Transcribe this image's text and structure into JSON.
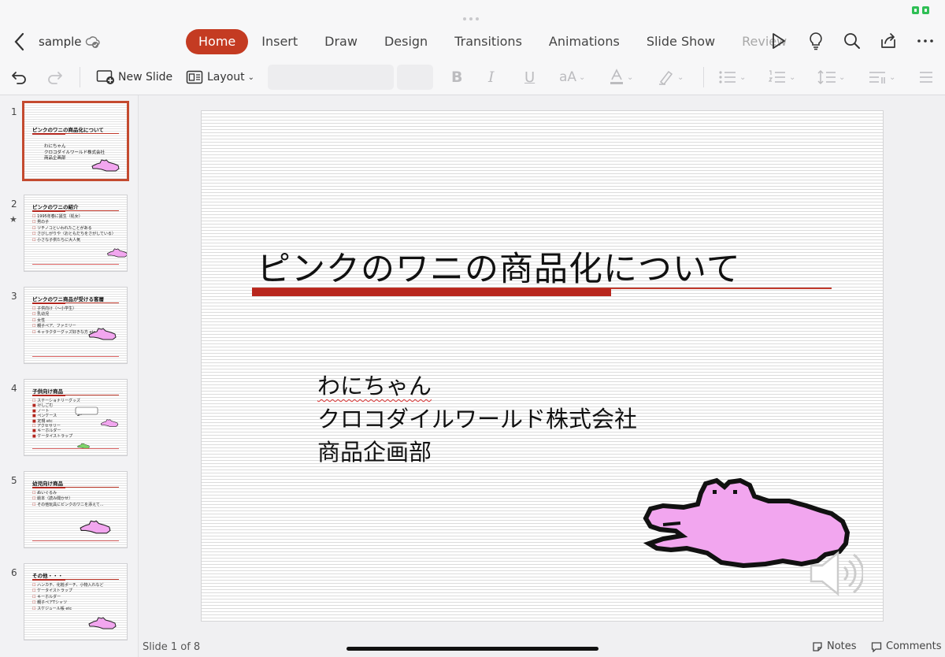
{
  "doc": {
    "title": "sample"
  },
  "tabs": [
    {
      "label": "Home",
      "active": true
    },
    {
      "label": "Insert"
    },
    {
      "label": "Draw"
    },
    {
      "label": "Design"
    },
    {
      "label": "Transitions"
    },
    {
      "label": "Animations"
    },
    {
      "label": "Slide Show"
    },
    {
      "label": "Review"
    }
  ],
  "ribbon": {
    "new_slide": "New Slide",
    "layout": "Layout",
    "font_case": "aA"
  },
  "slide": {
    "title": "ピンクのワニの商品化について",
    "subtitle_lines": [
      "わにちゃん",
      "クロコダイルワールド株式会社",
      "商品企画部"
    ]
  },
  "thumbnails": [
    {
      "num": "1",
      "title": "ピンクのワニの商品化について",
      "sub": [
        "わにちゃん",
        "クロコダイルワールド株式会社",
        "商品企画部"
      ]
    },
    {
      "num": "2",
      "title": "ピンクのワニの紹介",
      "items": [
        "1995年春に誕生（処女）",
        "男の子",
        "ツチノコといわれたことがある",
        "さびしがりや（おともだちをさがしている）",
        "小さな子供たちに大人気"
      ]
    },
    {
      "num": "3",
      "title": "ピンクのワニ商品が受ける客層",
      "items": [
        "子供向け（〜小学生）",
        "乳幼児",
        "女性",
        "親子ペア、ファミリー",
        "キャラクターグッズ好きな方 etc..."
      ]
    },
    {
      "num": "4",
      "title": "子供向け商品",
      "items": [
        "ステーショナリーグッズ",
        "けしごむ",
        "ノート",
        "ペンケース",
        "定規 etc",
        "アクセサリー",
        "キーホルダー",
        "ケータイストラップ"
      ]
    },
    {
      "num": "5",
      "title": "幼児向け商品",
      "items": [
        "ぬいぐるみ",
        "絵本（読み聞かせ）",
        "その他玩具にピンクのワニを添えて..."
      ]
    },
    {
      "num": "6",
      "title": "その他・・・",
      "items": [
        "ハンカチ、化粧ポーチ、小物入れなど",
        "ケータイストラップ",
        "キーホルダー",
        "親子ペアTシャツ",
        "スケジュール帳 etc"
      ]
    }
  ],
  "status": {
    "slide_count": "Slide 1 of 8",
    "notes": "Notes",
    "comments": "Comments"
  },
  "colors": {
    "accent": "#c43b22",
    "croc_pink": "#f2a6ef",
    "title_bar": "#b8261d"
  }
}
